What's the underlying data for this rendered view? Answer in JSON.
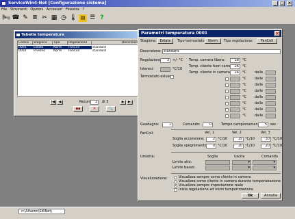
{
  "app": {
    "title": "ServiceWin4-Net [Configurazione sistema]",
    "menu": [
      "File",
      "Strumenti",
      "Opzioni",
      "Accessori",
      "Finestra",
      "?"
    ],
    "status_path": "c:\\Alfacon\\SWNet\\"
  },
  "table_window": {
    "title": "Tabella temperature",
    "columns": [
      "Codice",
      "Stagione",
      "Tipo",
      "Regolazione",
      "Descrizione"
    ],
    "rows": [
      [
        "0001",
        "Estate",
        "Norm",
        "FanCoil",
        "standard"
      ],
      [
        "0002",
        "Inverno",
        "Norm",
        "FanCoil",
        "standard"
      ]
    ],
    "record_label": "Record",
    "record_value": "1",
    "record_of": "di 3"
  },
  "dialog": {
    "title": "Parametri temperatura 0001",
    "stagione_label": "Stagione:",
    "stagione_value": "Estate",
    "tipo_termostato_label": "Tipo termostato:",
    "tipo_termostato_value": "Norm",
    "tipo_regolazione_label": "Tipo regolazione:",
    "tipo_regolazione_value": "FanCoil",
    "descrizione_label": "Descrizione:",
    "descrizione_value": "standard",
    "regolazione_label": "Regolazione:",
    "regolazione_value": "3",
    "regolazione_unit": "+/- °C",
    "isteresi_label": "Isteresi:",
    "isteresi_unit": "°C/10",
    "termostato_label": "Termostato esluso",
    "temp_camera_libera_label": "Temp. camera libera:",
    "temp_camera_libera_value": "28",
    "temp_cliente_fuori_label": "Temp. cliente fuori camera:",
    "temp_cliente_fuori_value": "26",
    "temp_cliente_in_label": "Temp. cliente in camera:",
    "temp_cliente_in_value": "24",
    "unit_c": "°C",
    "dalle_label": "dalle",
    "guadagno_label": "Guadagno:",
    "guadagno_value": "1",
    "comando_label": "Comando:",
    "comando_value": "0",
    "tempo_label": "Tempo campionamento:",
    "tempo_value": "5",
    "tempo_unit": "sec.",
    "fancoil_label": "FanCoil:",
    "vel_headers": [
      "Vel. 1",
      "Vel. 2",
      "Vel. 3"
    ],
    "soglia_accensione_label": "Soglia accensione:",
    "soglia_accensione_values": [
      "2",
      "15",
      "30"
    ],
    "soglia_spegnimento_label": "Soglia spegnimento:",
    "soglia_spegnimento_values": [
      "0",
      "10",
      "20"
    ],
    "unit_c10": "°C/10",
    "umidita_label": "Umidità:",
    "umidita_headers": [
      "Soglia",
      "Uscita",
      "Comando"
    ],
    "limite_alto_label": "Limite alto:",
    "limite_basso_label": "Limite basso:",
    "visualizzazione_label": "Visualizzazione:",
    "vis_options": [
      "Visualizza sempre come cliente in camera",
      "Visualizza come cliente in camera durante temporizzazione",
      "Visualizza sempre impostazione reale",
      "Inizia regolazione ad inizio temporizzazione"
    ],
    "ok_label": "Ok",
    "annulla_label": "Annulla"
  }
}
